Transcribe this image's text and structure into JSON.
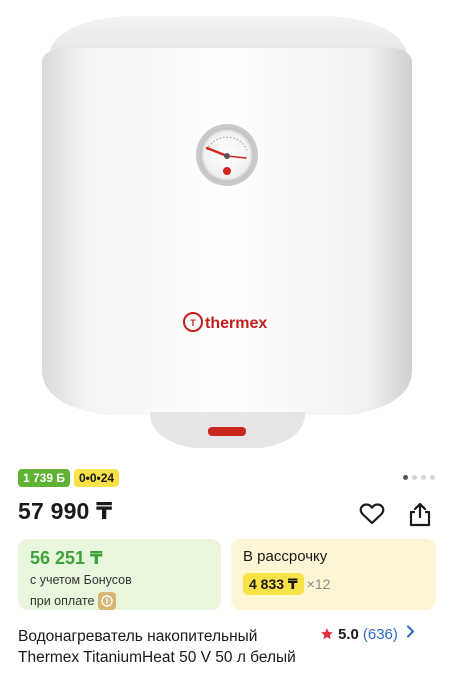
{
  "gallery": {
    "brand_logo_text": "thermex",
    "dots_total": 4,
    "dots_active_index": 0
  },
  "badges": {
    "bonus": "1 739 Б",
    "installment": "0•0•24"
  },
  "price": {
    "value": "57 990 ₸"
  },
  "icons": {
    "favorite": "heart-icon",
    "share": "share-icon",
    "star": "star-icon",
    "chevron": "chevron-right-icon",
    "coin": "coin-icon"
  },
  "bonus_card": {
    "price": "56 251 ₸",
    "line1": "с учетом Бонусов",
    "line2": "при оплате"
  },
  "installment_card": {
    "title": "В рассрочку",
    "amount": "4 833 ₸",
    "times": "×12"
  },
  "product": {
    "title": "Водонагреватель накопительный Thermex TitaniumHeat 50 V 50 л белый"
  },
  "rating": {
    "value": "5.0",
    "count": "(636)"
  },
  "colors": {
    "accent_green": "#5fb233",
    "accent_yellow": "#f9e247",
    "link_blue": "#2a6cc7",
    "star_red": "#e0313a"
  }
}
